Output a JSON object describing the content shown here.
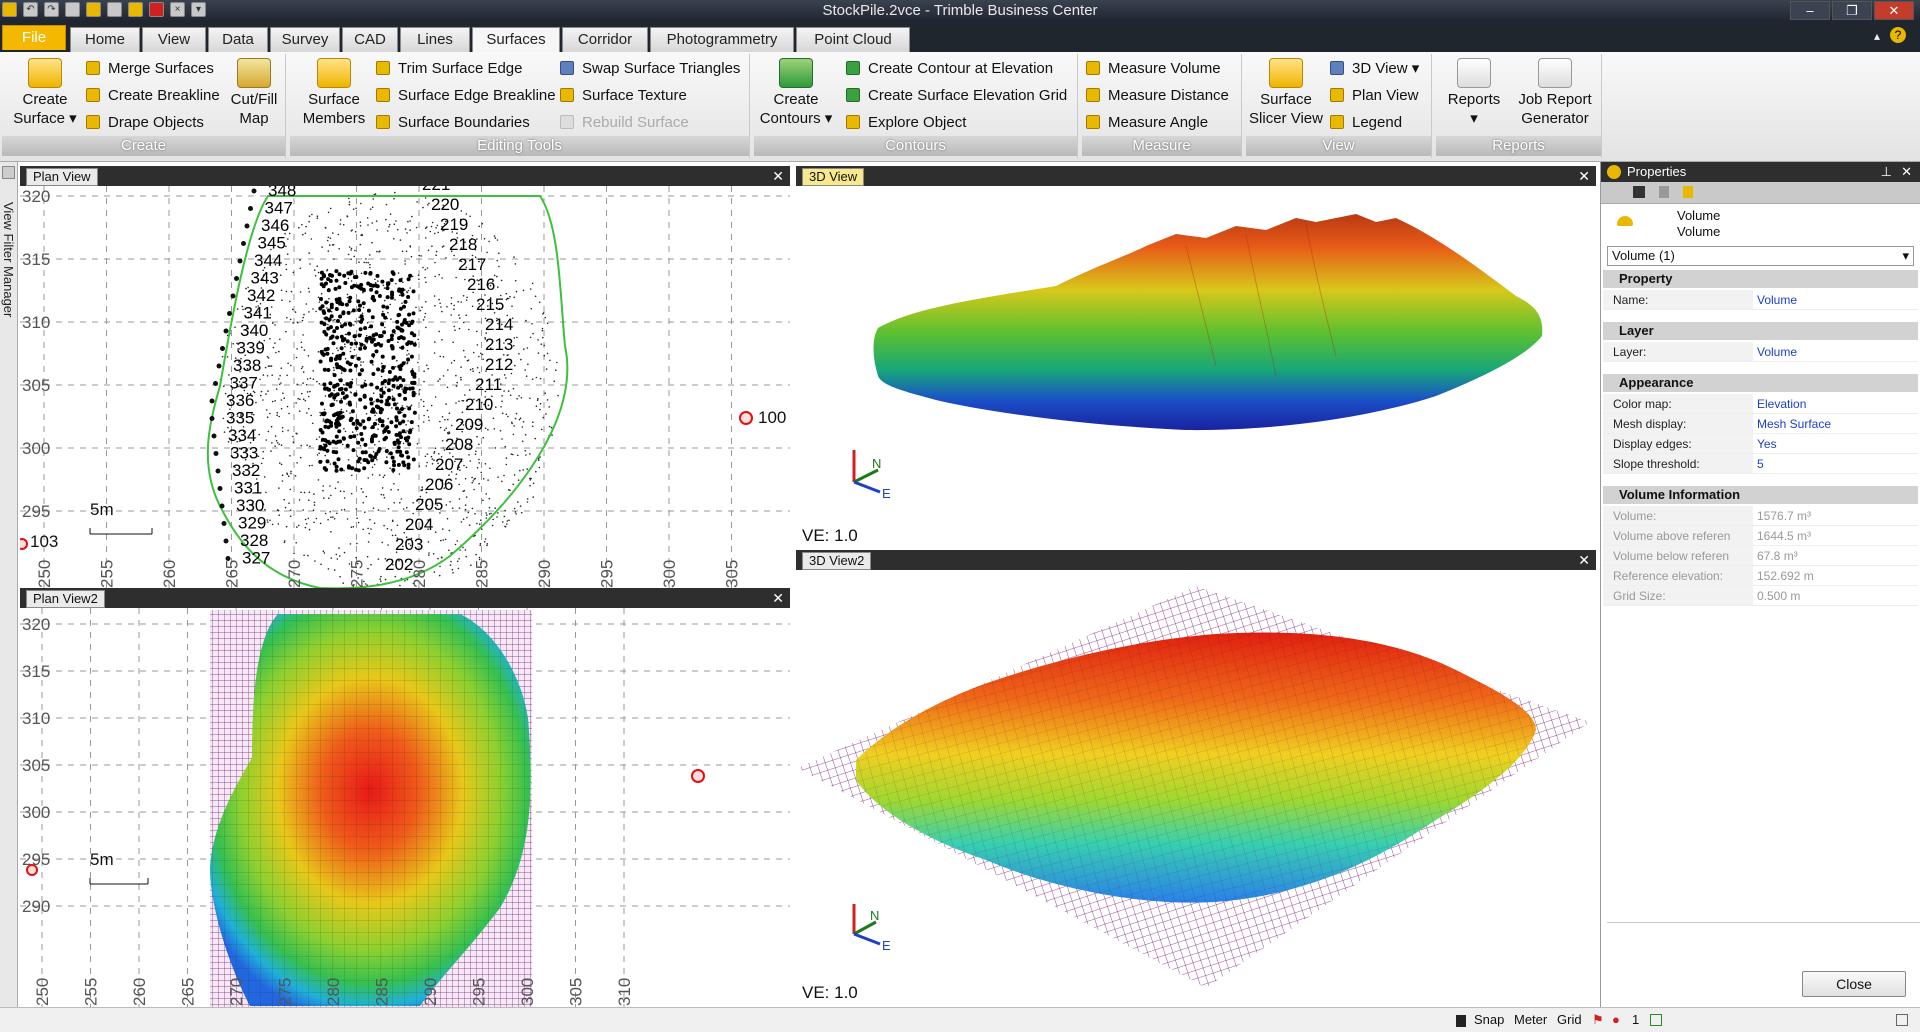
{
  "window": {
    "title": "StockPile.2vce - Trimble Business Center"
  },
  "ribbon_tabs": [
    "File",
    "Home",
    "View",
    "Data",
    "Survey",
    "CAD",
    "Lines",
    "Surfaces",
    "Corridor",
    "Photogrammetry",
    "Point Cloud"
  ],
  "active_tab": "Surfaces",
  "groups": {
    "create": {
      "label": "Create",
      "create_surface": "Create Surface",
      "merge": "Merge Surfaces",
      "breakline": "Create Breakline",
      "drape": "Drape Objects",
      "cutfill": "Cut/Fill Map"
    },
    "editing": {
      "label": "Editing Tools",
      "members": "Surface Members",
      "trim": "Trim Surface Edge",
      "edge_breakline": "Surface Edge Breakline",
      "boundaries": "Surface Boundaries",
      "swap": "Swap Surface Triangles",
      "texture": "Surface Texture",
      "rebuild": "Rebuild Surface"
    },
    "contours": {
      "label": "Contours",
      "create_contours": "Create Contours",
      "contour_elev": "Create Contour at Elevation",
      "elev_grid": "Create Surface Elevation Grid",
      "explore": "Explore Object"
    },
    "measure": {
      "label": "Measure",
      "volume": "Measure Volume",
      "distance": "Measure Distance",
      "angle": "Measure Angle"
    },
    "view": {
      "label": "View",
      "slicer": "Surface Slicer View",
      "view3d": "3D View",
      "plan": "Plan View",
      "legend": "Legend"
    },
    "reports": {
      "label": "Reports",
      "reports": "Reports",
      "job_report": "Job Report Generator"
    }
  },
  "side_panel": {
    "label": "View Filter Manager"
  },
  "plan_view": {
    "title": "Plan View",
    "y_ticks": [
      "320",
      "315",
      "310",
      "305",
      "300",
      "295"
    ],
    "x_ticks": [
      "250",
      "255",
      "260",
      "265",
      "270",
      "275",
      "280",
      "285",
      "290",
      "295",
      "300",
      "305"
    ],
    "scale": "5m",
    "points_left": [
      "348",
      "347",
      "346",
      "345",
      "344",
      "343",
      "342",
      "341",
      "340",
      "339",
      "338",
      "337",
      "336",
      "335",
      "334",
      "333",
      "332",
      "331",
      "330",
      "329",
      "328",
      "327"
    ],
    "points_right": [
      "221",
      "220",
      "219",
      "218",
      "217",
      "216",
      "215",
      "214",
      "213",
      "212",
      "211",
      "210",
      "209",
      "208",
      "207",
      "206",
      "205",
      "204",
      "203",
      "202"
    ],
    "control": [
      "100",
      "103"
    ]
  },
  "plan_view2": {
    "title": "Plan View2",
    "y_ticks": [
      "320",
      "315",
      "310",
      "305",
      "300",
      "295",
      "290"
    ],
    "x_ticks": [
      "250",
      "255",
      "260",
      "265",
      "270",
      "275",
      "280",
      "285",
      "290",
      "295",
      "300",
      "305",
      "310"
    ],
    "scale": "5m"
  },
  "view3d": {
    "title": "3D View",
    "ve": "VE: 1.0",
    "axes": {
      "n": "N",
      "e": "E"
    }
  },
  "view3d2": {
    "title": "3D View2",
    "ve": "VE: 1.0",
    "axes": {
      "n": "N",
      "e": "E"
    }
  },
  "properties": {
    "title": "Properties",
    "header_line1": "Volume",
    "header_line2": "Volume",
    "selector": "Volume (1)",
    "sections": [
      {
        "name": "Property",
        "rows": [
          {
            "k": "Name:",
            "v": "Volume"
          }
        ]
      },
      {
        "name": "Layer",
        "rows": [
          {
            "k": "Layer:",
            "v": "Volume"
          }
        ]
      },
      {
        "name": "Appearance",
        "rows": [
          {
            "k": "Color map:",
            "v": "Elevation"
          },
          {
            "k": "Mesh display:",
            "v": "Mesh Surface"
          },
          {
            "k": "Display edges:",
            "v": "Yes"
          },
          {
            "k": "Slope threshold:",
            "v": "5"
          }
        ]
      },
      {
        "name": "Volume Information",
        "rows": [
          {
            "k": "Volume:",
            "v": "1576.7 m³"
          },
          {
            "k": "Volume above referen",
            "v": "1644.5 m³"
          },
          {
            "k": "Volume below referen",
            "v": "67.8 m³"
          },
          {
            "k": "Reference elevation:",
            "v": "152.692 m"
          },
          {
            "k": "Grid Size:",
            "v": "0.500 m"
          }
        ]
      }
    ],
    "close": "Close"
  },
  "status": {
    "snap": "Snap",
    "units": "Meter",
    "grid": "Grid",
    "count": "1"
  }
}
